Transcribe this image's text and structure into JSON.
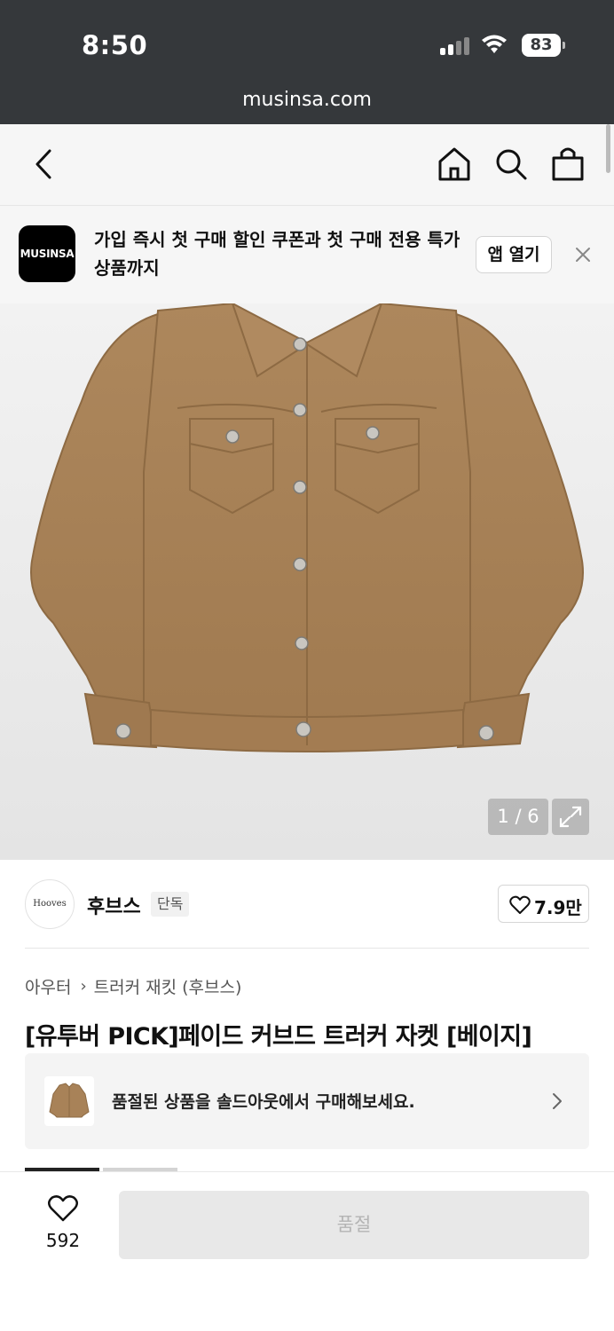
{
  "status_bar": {
    "time": "8:50",
    "battery": "83",
    "url": "musinsa.com"
  },
  "banner": {
    "logo_text": "MUSINSA",
    "message": "가입 즉시 첫 구매 할인 쿠폰과 첫 구매 전용 특가 상품까지",
    "open_app_label": "앱 열기"
  },
  "gallery": {
    "counter": "1 / 6"
  },
  "brand": {
    "logo_text": "Hooves",
    "name": "후브스",
    "badge": "단독",
    "likes": "7.9만"
  },
  "breadcrumb": {
    "category": "아우터",
    "subcategory": "트러커 재킷 (후브스)"
  },
  "product": {
    "title": "[유투버 PICK]페이드 커브드 트러커 자켓 [베이지]"
  },
  "soldout": {
    "message": "품절된 상품을 솔드아웃에서 구매해보세요."
  },
  "bottom_bar": {
    "wish_count": "592",
    "buy_label": "품절"
  },
  "colors": {
    "statusbar": "#35383b",
    "jacket": "#a88258",
    "disabled": "#e8e8e8"
  }
}
